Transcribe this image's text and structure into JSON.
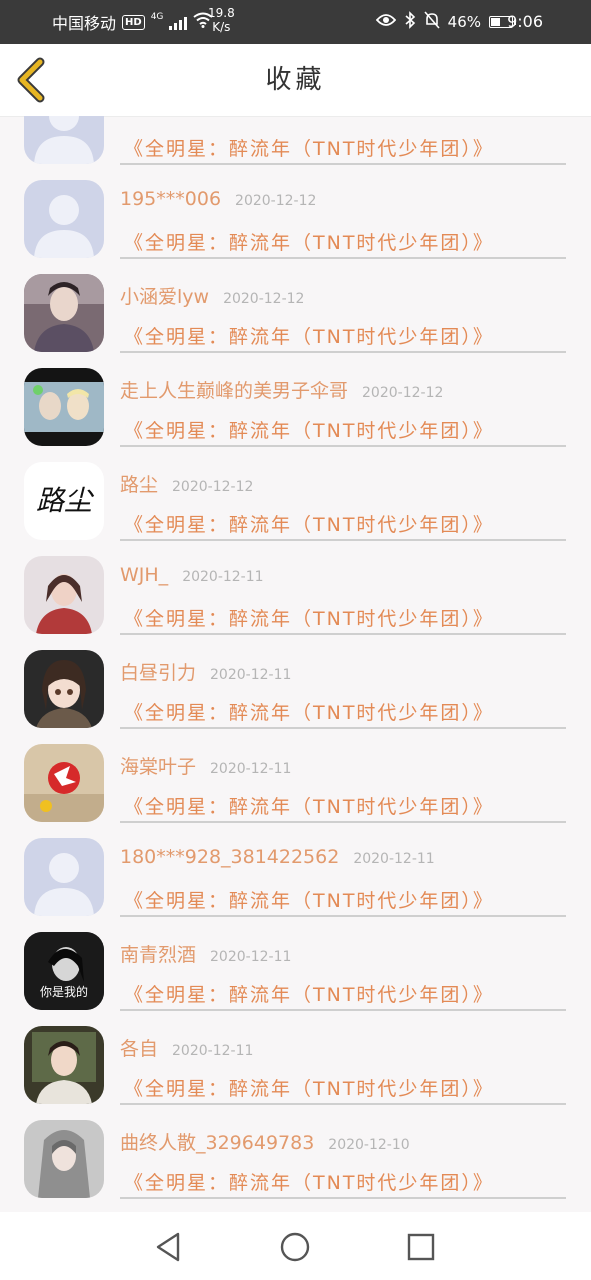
{
  "status_bar": {
    "carrier": "中国移动",
    "hd": "HD",
    "network": "4G",
    "speed_value": "19.8",
    "speed_unit": "K/s",
    "battery": "46%",
    "battery_level": 0.46,
    "time": "9:06"
  },
  "header": {
    "title": "收藏",
    "back_icon": "chevron-left-icon",
    "accent_color": "#e7b623"
  },
  "items": [
    {
      "user": "",
      "date": "",
      "song": "《全明星：醉流年（TNT时代少年团）》",
      "avatar": "default-avatar"
    },
    {
      "user": "195***006",
      "date": "2020-12-12",
      "song": "《全明星：醉流年（TNT时代少年团）》",
      "avatar": "default-avatar"
    },
    {
      "user": "小涵爱lyw",
      "date": "2020-12-12",
      "song": "《全明星：醉流年（TNT时代少年团）》",
      "avatar": "photo-avatar"
    },
    {
      "user": "走上人生巅峰的美男子伞哥",
      "date": "2020-12-12",
      "song": "《全明星：醉流年（TNT时代少年团）》",
      "avatar": "photo-avatar"
    },
    {
      "user": "路尘",
      "date": "2020-12-12",
      "song": "《全明星：醉流年（TNT时代少年团）》",
      "avatar": "calligraphy-avatar",
      "avatar_text": "路尘"
    },
    {
      "user": "WJH_",
      "date": "2020-12-11",
      "song": "《全明星：醉流年（TNT时代少年团）》",
      "avatar": "photo-avatar"
    },
    {
      "user": "白昼引力",
      "date": "2020-12-11",
      "song": "《全明星：醉流年（TNT时代少年团）》",
      "avatar": "photo-avatar"
    },
    {
      "user": "海棠叶子",
      "date": "2020-12-11",
      "song": "《全明星：醉流年（TNT时代少年团）》",
      "avatar": "photo-avatar"
    },
    {
      "user": "180***928_381422562",
      "date": "2020-12-11",
      "song": "《全明星：醉流年（TNT时代少年团）》",
      "avatar": "default-avatar"
    },
    {
      "user": "南青烈酒",
      "date": "2020-12-11",
      "song": "《全明星：醉流年（TNT时代少年团）》",
      "avatar": "photo-avatar",
      "avatar_text": "你是我的"
    },
    {
      "user": "各自",
      "date": "2020-12-11",
      "song": "《全明星：醉流年（TNT时代少年团）》",
      "avatar": "photo-avatar"
    },
    {
      "user": "曲终人散_329649783",
      "date": "2020-12-10",
      "song": "《全明星：醉流年（TNT时代少年团）》",
      "avatar": "photo-avatar"
    }
  ],
  "nav": {
    "back_icon": "triangle-back-icon",
    "home_icon": "circle-home-icon",
    "recents_icon": "square-recents-icon"
  }
}
